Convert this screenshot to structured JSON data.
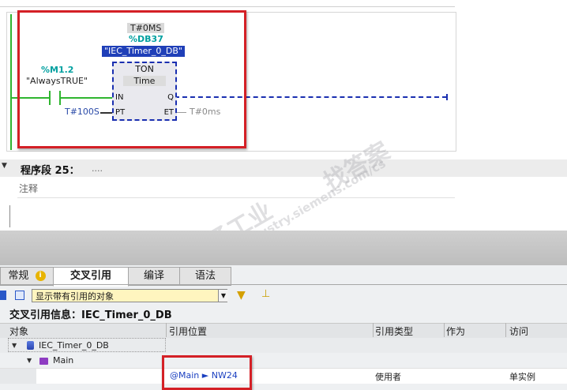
{
  "ladder": {
    "instance_value": "T#0MS",
    "db_address": "%DB37",
    "db_name": "\"IEC_Timer_0_DB\"",
    "contact_address": "%M1.2",
    "contact_name": "\"AlwaysTRUE\"",
    "block_type": "TON",
    "block_subtype": "Time",
    "pin_in": "IN",
    "pin_pt": "PT",
    "pin_q": "Q",
    "pin_et": "ET",
    "pt_value": "T#100S",
    "et_value": "T#0ms"
  },
  "network": {
    "label": "程序段 25：",
    "dots": "....",
    "comment": "注释"
  },
  "watermark": {
    "line1": "西门子工业",
    "line2": "找答案",
    "url": "support.industry.siemens.com/cs"
  },
  "inspector": {
    "tabs": [
      "常规",
      "交叉引用",
      "编译",
      "语法"
    ],
    "active_tab": "交叉引用",
    "filter_value": "显示带有引用的对象",
    "title": "交叉引用信息：IEC_Timer_0_DB",
    "columns": [
      "对象",
      "引用位置",
      "引用类型",
      "作为",
      "访问"
    ],
    "rows": [
      {
        "object": "IEC_Timer_0_DB",
        "location": "",
        "type": "",
        "as": "",
        "access": ""
      },
      {
        "object": "Main",
        "location": "",
        "type": "",
        "as": "",
        "access": ""
      },
      {
        "object": "",
        "location": "@Main ► NW24",
        "type": "使用者",
        "as": "",
        "access": "单实例"
      }
    ]
  },
  "colors": {
    "accent_highlight": "#d42026",
    "wire_active": "#2fb52f",
    "wire_output": "#1a2fb0",
    "tag_address": "#00a0a0",
    "filter_bg": "#fff5bf"
  }
}
